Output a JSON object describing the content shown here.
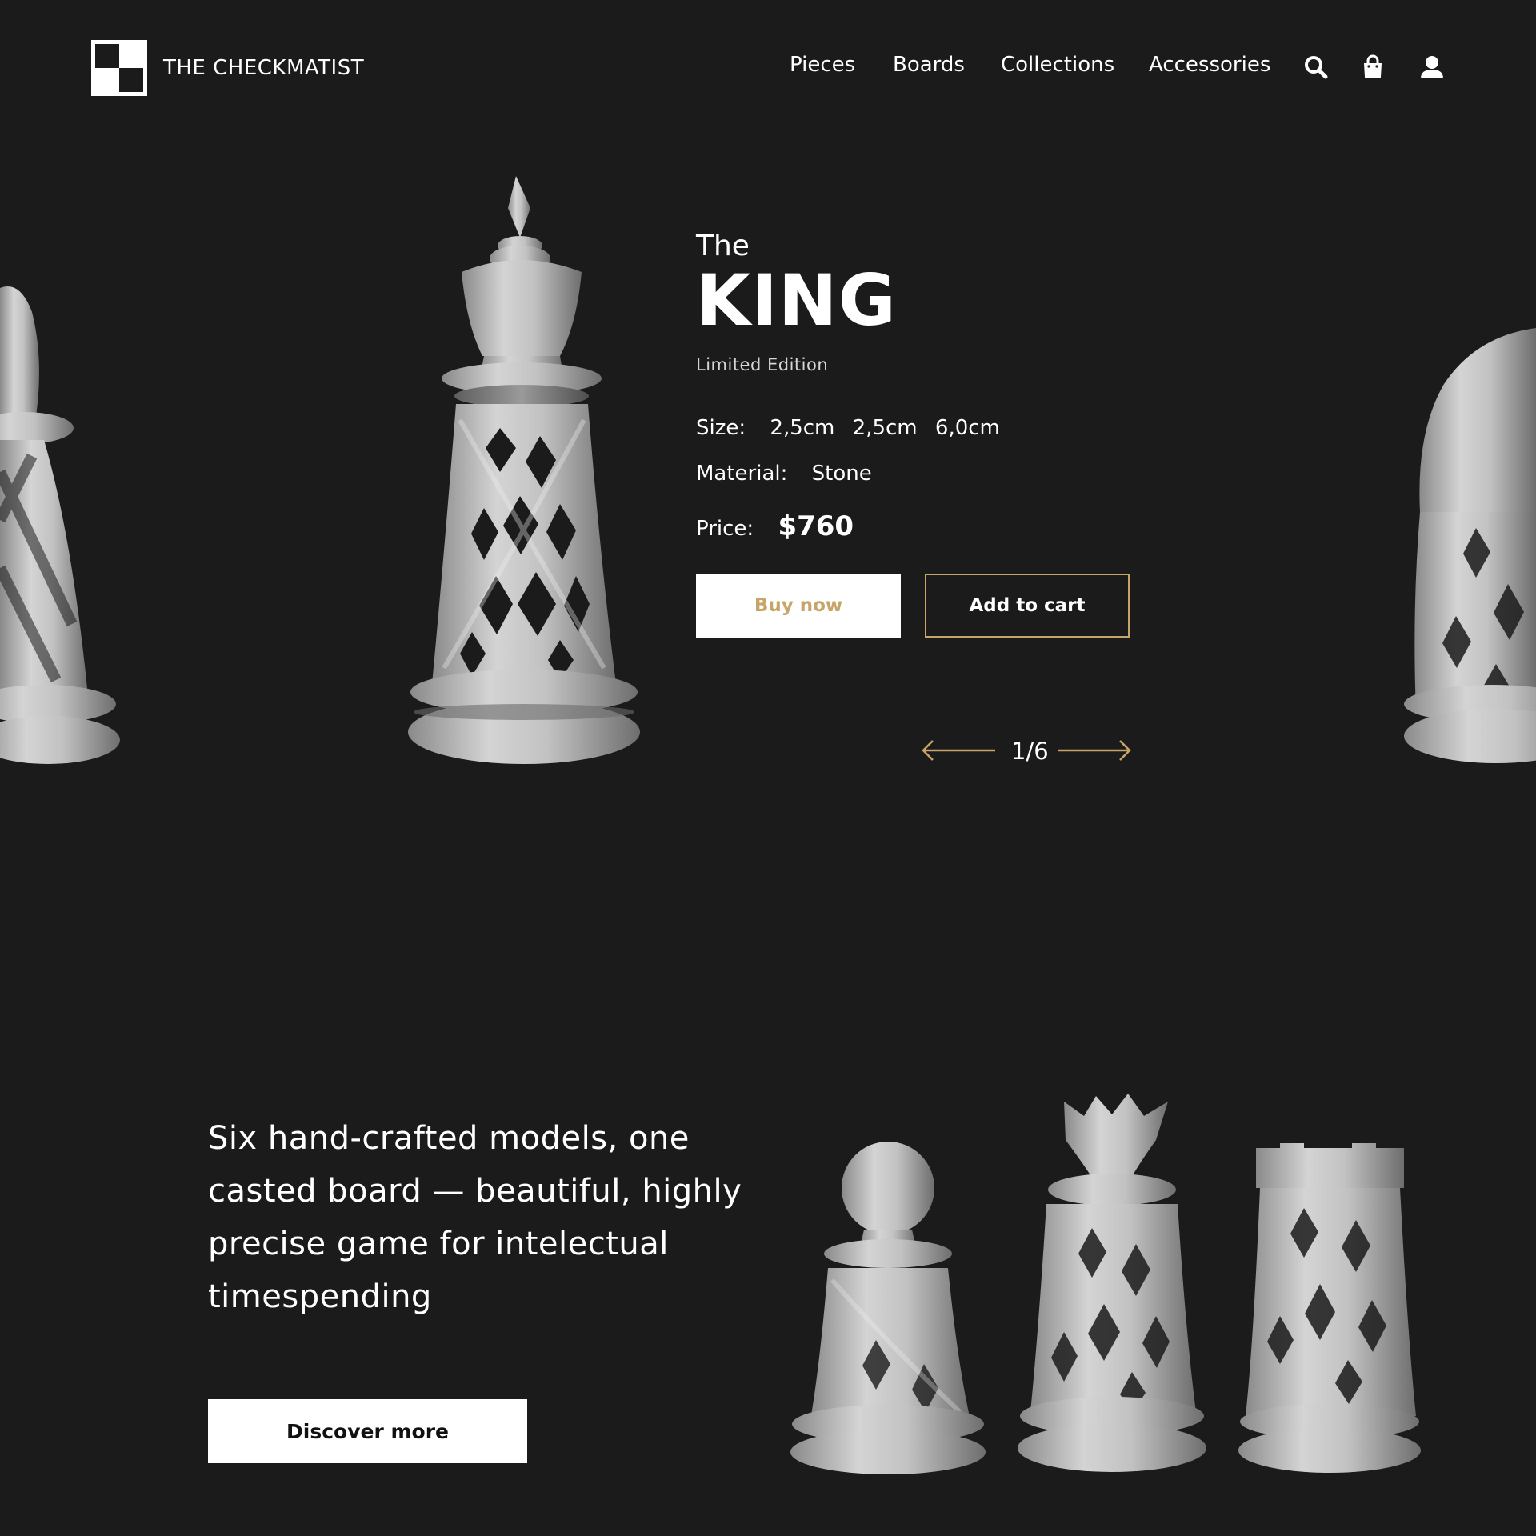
{
  "brand": {
    "name": "THE CHECKMATIST"
  },
  "nav": {
    "items": [
      "Pieces",
      "Boards",
      "Collections",
      "Accessories"
    ],
    "icons": [
      "search-icon",
      "shopping-bag-icon",
      "user-icon"
    ]
  },
  "hero": {
    "pre_title": "The",
    "title": "KING",
    "edition": "Limited Edition",
    "size": {
      "label": "Size:",
      "values": [
        "2,5cm",
        "2,5cm",
        "6,0cm"
      ]
    },
    "material": {
      "label": "Material:",
      "value": "Stone"
    },
    "price": {
      "label": "Price:",
      "value": "$760"
    },
    "buy_label": "Buy now",
    "cart_label": "Add to cart",
    "pager": {
      "current": "1/6"
    }
  },
  "collection": {
    "tagline": "Six hand-crafted models, one casted board — beautiful, highly precise game for intelectual timespending",
    "discover_label": "Discover more"
  },
  "colors": {
    "background": "#1b1b1c",
    "accent_gold": "#c7a468",
    "text": "#ffffff",
    "stone": "#c4c4c4"
  }
}
